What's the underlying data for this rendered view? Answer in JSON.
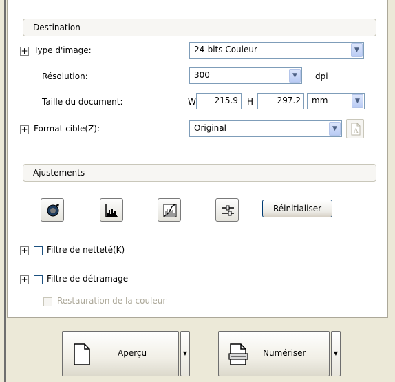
{
  "destination": {
    "header": "Destination",
    "image_type": {
      "label": "Type d'image:",
      "value": "24-bits Couleur"
    },
    "resolution": {
      "label": "Résolution:",
      "value": "300",
      "unit": "dpi"
    },
    "doc_size": {
      "label": "Taille du document:",
      "w_label": "W",
      "w_value": "215.9",
      "h_label": "H",
      "h_value": "297.2",
      "unit": "mm"
    },
    "target_format": {
      "label": "Format cible(Z):",
      "value": "Original"
    }
  },
  "adjustments": {
    "header": "Ajustements",
    "reset_label": "Réinitialiser",
    "icons": [
      "auto-exposure-icon",
      "histogram-icon",
      "tone-curve-icon",
      "color-balance-icon"
    ],
    "sharpen": {
      "label": "Filtre de netteté(K)",
      "checked": false
    },
    "descreen": {
      "label": "Filtre de détramage",
      "checked": false
    },
    "color_restore": {
      "label": "Restauration de la couleur",
      "checked": false,
      "enabled": false
    }
  },
  "actions": {
    "preview_label": "Aperçu",
    "scan_label": "Numériser"
  }
}
